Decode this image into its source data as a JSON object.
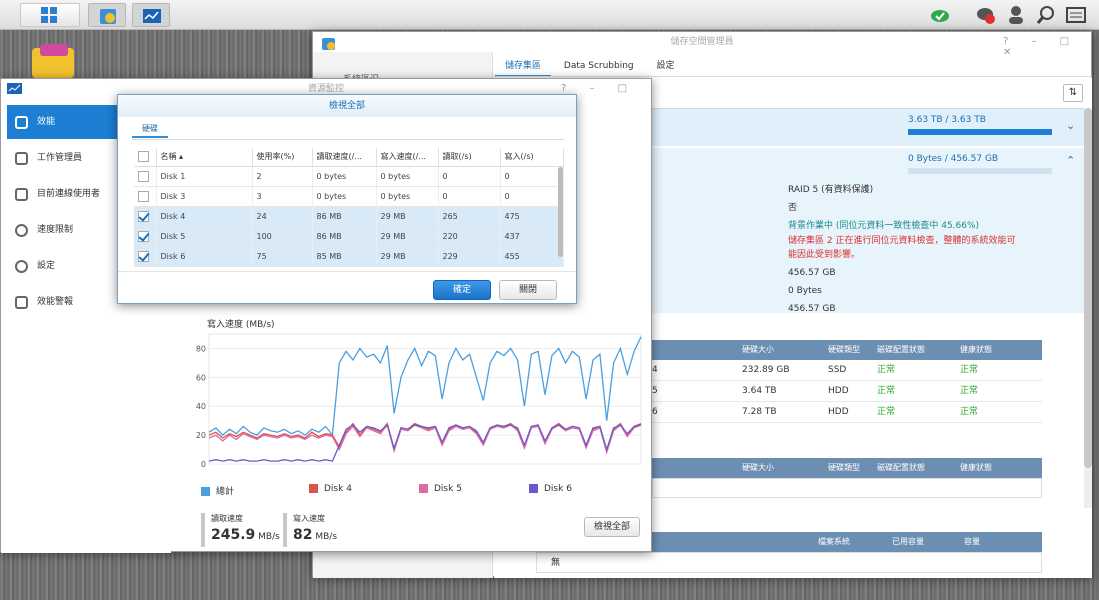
{
  "storage_manager": {
    "title": "儲存空間管理員",
    "tabs": [
      "儲存集區",
      "Data Scrubbing",
      "設定"
    ],
    "sidebar_partial": "系統區況",
    "pool1_usage": "3.63 TB / 3.63 TB",
    "pool2_usage": "0 Bytes / 456.57 GB",
    "details": [
      "RAID 5 (有資料保護)",
      "否",
      "背景作業中 (同位元資料一致性檢查中 45.66%)",
      "儲存集區 2 正在進行同位元資料檢查，整體的系統效能可能因此受到影響。",
      "456.57 GB",
      "0 Bytes",
      "456.57 GB"
    ],
    "disk_table_headers": [
      "硬碟大小",
      "硬碟類型",
      "磁碟配置狀態",
      "健康狀態"
    ],
    "disk_rows": [
      {
        "no": "4",
        "size": "232.89 GB",
        "type": "SSD",
        "alloc": "正常",
        "health": "正常"
      },
      {
        "no": "5",
        "size": "3.64 TB",
        "type": "HDD",
        "alloc": "正常",
        "health": "正常"
      },
      {
        "no": "6",
        "size": "7.28 TB",
        "type": "HDD",
        "alloc": "正常",
        "health": "正常"
      }
    ],
    "table2_headers": [
      "硬碟大小",
      "硬碟類型",
      "磁碟配置狀態",
      "健康狀態"
    ],
    "table3_headers": [
      "檔案系統",
      "已用容量",
      "容量"
    ],
    "table3_row": "無"
  },
  "resource_monitor": {
    "title": "資源監控",
    "nav": [
      "效能",
      "工作管理員",
      "目前連線使用者",
      "速度限制",
      "設定",
      "效能警報"
    ],
    "chart_title": "寫入速度 (MB/s)",
    "legend": [
      "總計",
      "Disk 4",
      "Disk 5",
      "Disk 6"
    ],
    "read_label": "讀取速度",
    "read_value": "245.9",
    "read_unit": "MB/s",
    "write_label": "寫入速度",
    "write_value": "82",
    "write_unit": "MB/s",
    "view_all_button": "檢視全部"
  },
  "dialog": {
    "title": "檢視全部",
    "tab": "硬碟",
    "headers": [
      "名稱 ▴",
      "使用率(%)",
      "讀取速度(/...",
      "寫入速度(/...",
      "讀取(/s)",
      "寫入(/s)"
    ],
    "rows": [
      {
        "checked": false,
        "name": "Disk 1",
        "util": "2",
        "read": "0 bytes",
        "write": "0 bytes",
        "rps": "0",
        "wps": "0"
      },
      {
        "checked": false,
        "name": "Disk 3",
        "util": "3",
        "read": "0 bytes",
        "write": "0 bytes",
        "rps": "0",
        "wps": "0"
      },
      {
        "checked": true,
        "name": "Disk 4",
        "util": "24",
        "read": "86 MB",
        "write": "29 MB",
        "rps": "265",
        "wps": "475"
      },
      {
        "checked": true,
        "name": "Disk 5",
        "util": "100",
        "read": "86 MB",
        "write": "29 MB",
        "rps": "220",
        "wps": "437"
      },
      {
        "checked": true,
        "name": "Disk 6",
        "util": "75",
        "read": "85 MB",
        "write": "29 MB",
        "rps": "229",
        "wps": "455"
      }
    ],
    "ok_button": "確定",
    "close_button": "關閉"
  },
  "chart_data": {
    "type": "line",
    "title": "寫入速度 (MB/s)",
    "ylim": [
      0,
      90
    ],
    "yticks": [
      0,
      20,
      40,
      60,
      80
    ],
    "series": [
      {
        "name": "總計",
        "color": "#4a9fe0",
        "values": [
          22,
          25,
          20,
          24,
          21,
          26,
          22,
          20,
          25,
          23,
          22,
          24,
          21,
          23,
          20,
          24,
          22,
          26,
          20,
          70,
          78,
          72,
          80,
          74,
          76,
          70,
          82,
          35,
          60,
          72,
          80,
          68,
          78,
          75,
          45,
          70,
          80,
          72,
          76,
          60,
          44,
          70,
          78,
          75,
          80,
          72,
          40,
          76,
          78,
          48,
          75,
          80,
          70,
          78,
          74,
          45,
          72,
          76,
          30,
          70,
          80,
          62,
          78,
          88
        ]
      },
      {
        "name": "Disk 4",
        "color": "#d9534f",
        "values": [
          20,
          22,
          18,
          21,
          19,
          22,
          20,
          18,
          21,
          20,
          19,
          21,
          19,
          20,
          18,
          22,
          19,
          21,
          20,
          12,
          22,
          28,
          20,
          26,
          24,
          22,
          28,
          10,
          25,
          24,
          28,
          26,
          24,
          26,
          14,
          24,
          27,
          25,
          26,
          22,
          14,
          25,
          27,
          26,
          28,
          24,
          12,
          26,
          27,
          15,
          25,
          28,
          24,
          26,
          25,
          12,
          24,
          26,
          9,
          24,
          28,
          20,
          26,
          28
        ]
      },
      {
        "name": "Disk 5",
        "color": "#e06aa0",
        "values": [
          18,
          20,
          16,
          20,
          17,
          21,
          19,
          17,
          20,
          19,
          18,
          20,
          18,
          19,
          17,
          20,
          18,
          20,
          19,
          10,
          21,
          26,
          19,
          25,
          23,
          21,
          27,
          9,
          24,
          23,
          27,
          25,
          23,
          25,
          13,
          23,
          26,
          24,
          25,
          21,
          13,
          24,
          26,
          25,
          27,
          23,
          11,
          25,
          26,
          14,
          24,
          27,
          23,
          25,
          24,
          11,
          23,
          25,
          8,
          23,
          27,
          19,
          25,
          27
        ]
      },
      {
        "name": "Disk 6",
        "color": "#6a5acd",
        "values": [
          2,
          3,
          2,
          3,
          2,
          3,
          2,
          2,
          3,
          2,
          2,
          3,
          2,
          3,
          2,
          3,
          2,
          3,
          2,
          13,
          24,
          27,
          22,
          26,
          25,
          23,
          27,
          11,
          25,
          24,
          27,
          26,
          25,
          26,
          15,
          25,
          27,
          25,
          26,
          23,
          15,
          25,
          27,
          26,
          27,
          25,
          13,
          26,
          27,
          16,
          25,
          27,
          24,
          26,
          25,
          13,
          25,
          26,
          10,
          25,
          27,
          21,
          26,
          27
        ]
      }
    ]
  }
}
